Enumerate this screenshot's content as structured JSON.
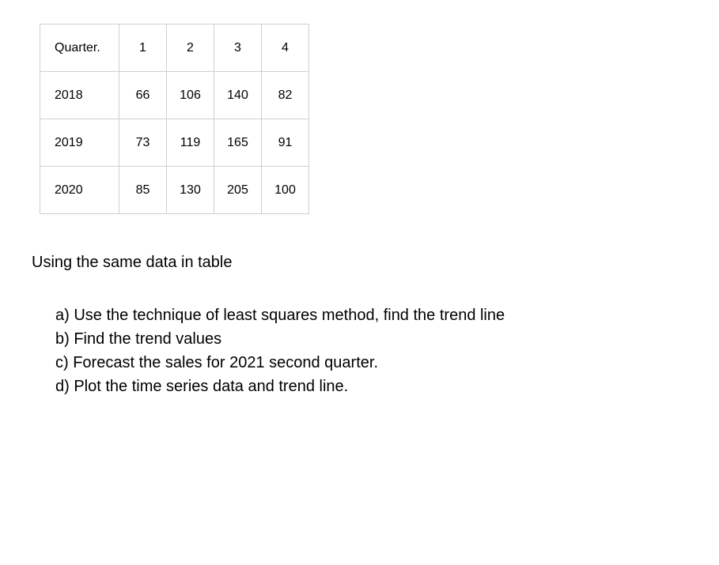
{
  "table": {
    "header": {
      "label": "Quarter.",
      "cols": [
        "1",
        "2",
        "3",
        "4"
      ]
    },
    "rows": [
      {
        "year": "2018",
        "values": [
          "66",
          "106",
          "140",
          "82"
        ]
      },
      {
        "year": "2019",
        "values": [
          "73",
          "119",
          "165",
          "91"
        ]
      },
      {
        "year": "2020",
        "values": [
          "85",
          "130",
          "205",
          "100"
        ]
      }
    ]
  },
  "intro": "Using the same data in table",
  "questions": {
    "a": "a) Use the technique of least squares method, find the trend line",
    "b": "b) Find the trend values",
    "c": "c) Forecast the sales for 2021 second quarter.",
    "d": "d) Plot the time series data and trend line."
  },
  "chart_data": {
    "type": "table",
    "title": "Quarterly data by year",
    "columns": [
      "Quarter",
      "1",
      "2",
      "3",
      "4"
    ],
    "rows": [
      {
        "Quarter": "2018",
        "1": 66,
        "2": 106,
        "3": 140,
        "4": 82
      },
      {
        "Quarter": "2019",
        "1": 73,
        "2": 119,
        "3": 165,
        "4": 91
      },
      {
        "Quarter": "2020",
        "1": 85,
        "2": 130,
        "3": 205,
        "4": 100
      }
    ]
  }
}
